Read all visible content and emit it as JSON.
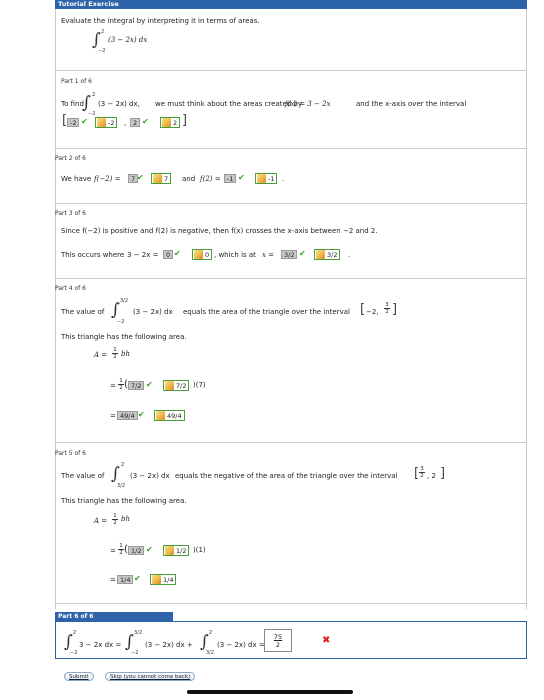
{
  "header": {
    "title": "Tutorial Exercise"
  },
  "prompt": {
    "text": "Evaluate the integral by interpreting it in terms of areas.",
    "integrand": "(3 − 2x) dx",
    "upper": "2",
    "lower": "−2"
  },
  "part1": {
    "label": "Part 1 of 6",
    "to_find": "To find",
    "integrand": "(3 − 2x) dx,",
    "upper": "2",
    "lower": "−2",
    "text": "we must think about the areas created by",
    "fx": "f(x) = 3 − 2x",
    "tail": "and the x-axis over the interval",
    "input1": "-2",
    "answer1": "-2",
    "input2": "2",
    "answer2": "2"
  },
  "part2": {
    "label": "Part 2 of 6",
    "we_have": "We have",
    "f_neg2": "f(−2) =",
    "input1": "7",
    "answer1": "7",
    "and": "and",
    "f_2": "f(2) =",
    "input2": "-1",
    "answer2": "-1"
  },
  "part3": {
    "label": "Part 3 of 6",
    "since": "Since f(−2) is positive and f(2) is negative, then f(x) crosses the x-axis between −2 and 2.",
    "occurs": "This occurs where",
    "expr": "3 − 2x =",
    "input1": "0",
    "answer1": "0",
    "which": ", which is at",
    "x_eq": "x =",
    "input2": "3/2",
    "answer2": "3/2"
  },
  "part4": {
    "label": "Part 4 of 6",
    "the_value": "The value of",
    "upper": "3/2",
    "lower": "−2",
    "integrand": "(3 − 2x) dx",
    "equals": "equals the area of the triangle over the interval",
    "interval_left": "−2,",
    "interval_num": "3",
    "interval_den": "2",
    "triangle_text": "This triangle has the following area.",
    "area_label": "A =",
    "half_num": "1",
    "half_den": "2",
    "bh": "bh",
    "input1": "7/2",
    "answer1": "7/2",
    "times": ")(7)",
    "input2": "49/4",
    "answer2": "49/4"
  },
  "part5": {
    "label": "Part 5 of 6",
    "the_value": "The value of",
    "upper": "2",
    "lower": "3/2",
    "integrand": "(3 − 2x) dx",
    "equals": "equals the negative of the area of the triangle over the interval",
    "interval_num": "3",
    "interval_den": "2",
    "interval_right": ", 2",
    "triangle_text": "This triangle has the following area.",
    "area_label": "A =",
    "half_num": "1",
    "half_den": "2",
    "bh": "bh",
    "input1": "1/2",
    "answer1": "1/2",
    "times": ")(1)",
    "input2": "1/4",
    "answer2": "1/4"
  },
  "part6": {
    "label": "Part 6 of 6",
    "lhs_integrand": "3 − 2x dx =",
    "lhs_upper": "2",
    "lhs_lower": "−2",
    "mid_integrand": "(3 − 2x) dx +",
    "mid_upper": "3/2",
    "mid_lower": "−2",
    "rhs_integrand": "(3 − 2x) dx =",
    "rhs_upper": "2",
    "rhs_lower": "3/2",
    "answer_num": "75",
    "answer_den": "2",
    "result_icon": "x-mark-icon"
  },
  "buttons": {
    "submit": "Submit",
    "skip": "Skip (you cannot come back)"
  },
  "colors": {
    "header": "#2d63a8",
    "correct": "#3a9a2a",
    "incorrect": "#d22222"
  }
}
